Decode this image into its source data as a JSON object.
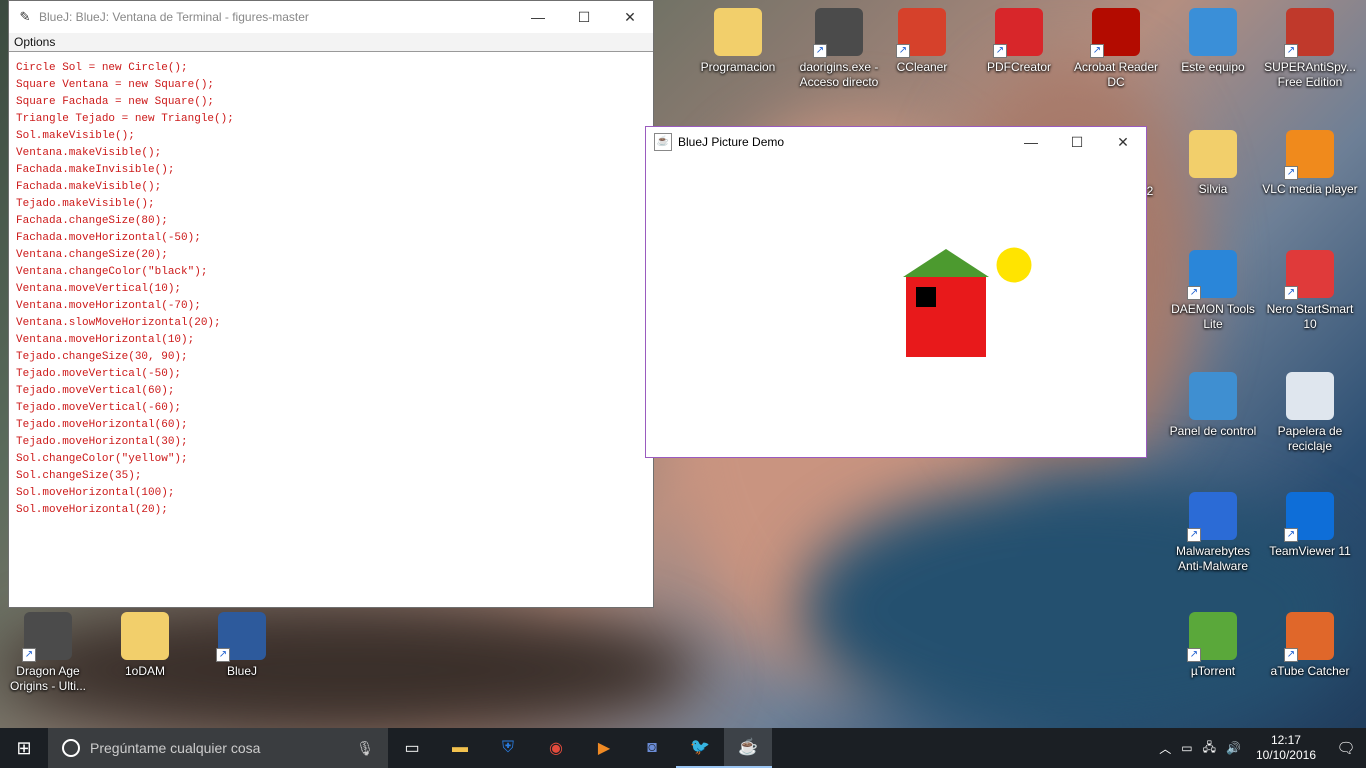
{
  "terminal": {
    "title": "BlueJ: BlueJ:  Ventana de Terminal - figures-master",
    "menu": "Options",
    "lines": [
      "Circle Sol = new Circle();",
      "Square Ventana = new Square();",
      "Square Fachada = new Square();",
      "Triangle Tejado = new Triangle();",
      "Sol.makeVisible();",
      "Ventana.makeVisible();",
      "Fachada.makeInvisible();",
      "Fachada.makeVisible();",
      "Tejado.makeVisible();",
      "Fachada.changeSize(80);",
      "Fachada.moveHorizontal(-50);",
      "Ventana.changeSize(20);",
      "Ventana.changeColor(\"black\");",
      "Ventana.moveVertical(10);",
      "Ventana.moveHorizontal(-70);",
      "Ventana.slowMoveHorizontal(20);",
      "Ventana.moveHorizontal(10);",
      "Tejado.changeSize(30, 90);",
      "Tejado.moveVertical(-50);",
      "Tejado.moveVertical(60);",
      "Tejado.moveVertical(-60);",
      "Tejado.moveHorizontal(60);",
      "Tejado.moveHorizontal(30);",
      "Sol.changeColor(\"yellow\");",
      "Sol.changeSize(35);",
      "Sol.moveHorizontal(100);",
      "Sol.moveHorizontal(20);"
    ]
  },
  "demo": {
    "title": "BlueJ Picture Demo",
    "colors": {
      "house": "#e8191b",
      "roof": "#4c9a2f",
      "window": "#000000",
      "sun": "#ffe400"
    }
  },
  "desktop": {
    "icons": [
      {
        "label": "Programacion",
        "icon": "folder-icon"
      },
      {
        "label": "daorigins.exe - Acceso directo",
        "icon": "dragon-age-icon"
      },
      {
        "label": "CCleaner",
        "icon": "ccleaner-icon"
      },
      {
        "label": "PDFCreator",
        "icon": "pdfcreator-icon"
      },
      {
        "label": "Acrobat Reader DC",
        "icon": "acrobat-icon"
      },
      {
        "label": "Este equipo",
        "icon": "computer-icon"
      },
      {
        "label": "SUPERAntiSpy... Free Edition",
        "icon": "superantispyware-icon"
      },
      {
        "label": "Silvia",
        "icon": "folder-icon"
      },
      {
        "label": "VLC media player",
        "icon": "vlc-icon"
      },
      {
        "label": "DAEMON Tools Lite",
        "icon": "daemon-tools-icon"
      },
      {
        "label": "Nero StartSmart 10",
        "icon": "nero-icon"
      },
      {
        "label": "Panel de control",
        "icon": "control-panel-icon"
      },
      {
        "label": "Papelera de reciclaje",
        "icon": "recycle-bin-icon"
      },
      {
        "label": "Malwarebytes Anti-Malware",
        "icon": "malwarebytes-icon"
      },
      {
        "label": "TeamViewer 11",
        "icon": "teamviewer-icon"
      },
      {
        "label": "Dragon Age Origins - Ulti...",
        "icon": "dragon-age-icon"
      },
      {
        "label": "1oDAM",
        "icon": "folder-icon"
      },
      {
        "label": "BlueJ",
        "icon": "bluej-icon"
      },
      {
        "label": "µTorrent",
        "icon": "utorrent-icon"
      },
      {
        "label": "aTube Catcher",
        "icon": "atube-catcher-icon"
      }
    ],
    "partial_label": "2"
  },
  "taskbar": {
    "search_placeholder": "Pregúntame cualquier cosa",
    "time": "12:17",
    "date": "10/10/2016"
  }
}
